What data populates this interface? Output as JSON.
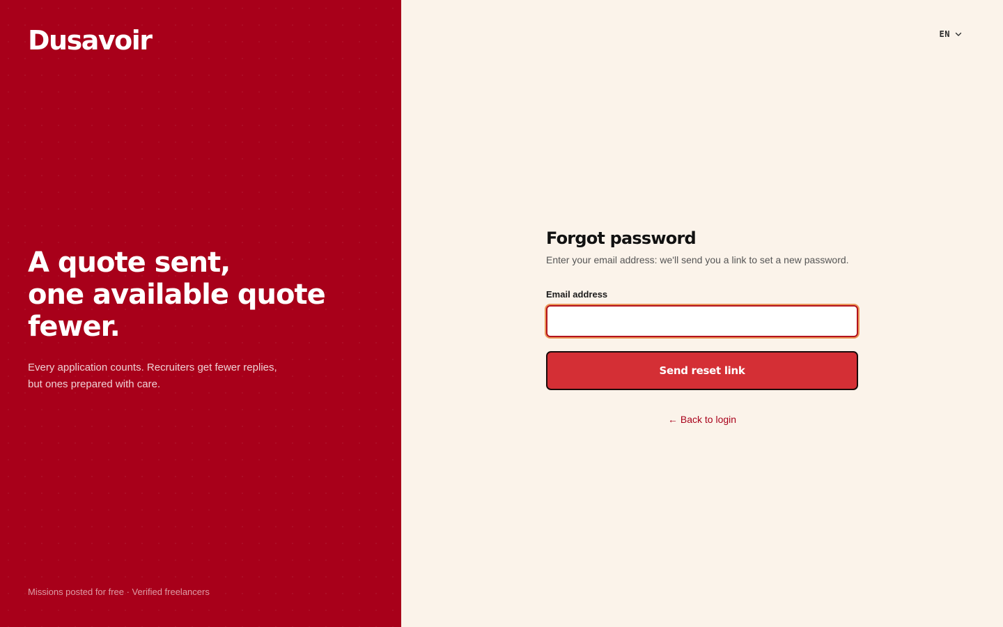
{
  "brand": {
    "name": "Dusavoir",
    "headline_lines": [
      "A quote sent,",
      "one available quote",
      "fewer."
    ],
    "subtext_lines": [
      "Every application counts. Recruiters get fewer replies,",
      "but ones prepared with care."
    ],
    "footer": "Missions posted for free · Verified freelancers",
    "background_color": "#a8001a"
  },
  "language": {
    "selected": "EN",
    "icon": "chevron-down-icon"
  },
  "form": {
    "title": "Forgot password",
    "description": "Enter your email address: we'll send you a link to set a new password.",
    "email_label": "Email address",
    "email_value": "",
    "email_placeholder": "",
    "submit_label": "Send reset link",
    "back_arrow": "←",
    "back_label": "Back to login"
  },
  "colors": {
    "accent": "#d42f35",
    "link": "#a8001a",
    "panel_background": "#fbf3ea"
  }
}
